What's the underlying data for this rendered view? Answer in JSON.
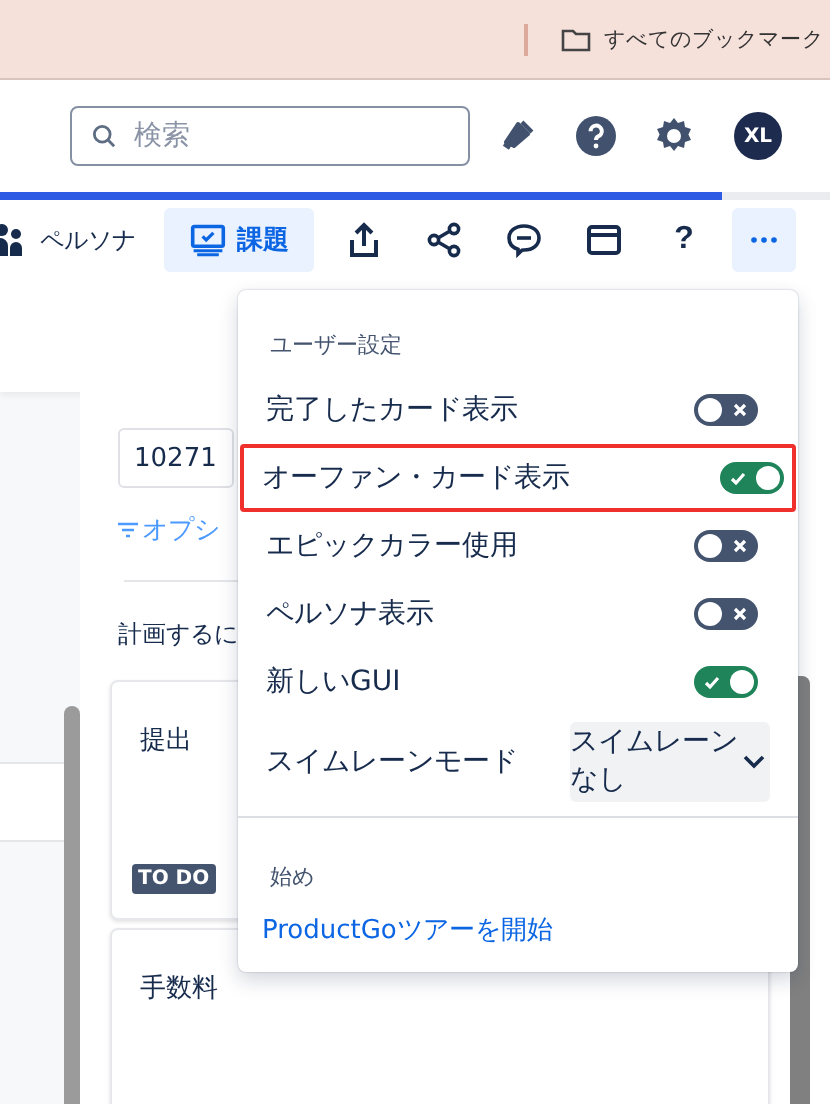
{
  "bookmarks_bar": {
    "label": "すべてのブックマーク"
  },
  "header": {
    "search": {
      "placeholder": "検索"
    },
    "avatar": "XL"
  },
  "progress": {
    "level": 0.87
  },
  "toolbar": {
    "tabs": [
      {
        "label": "ペルソナ",
        "selected": false
      },
      {
        "label": "課題",
        "selected": true
      }
    ],
    "icon_buttons": [
      {
        "kind": "upload",
        "selected": false
      },
      {
        "kind": "share",
        "selected": false
      },
      {
        "kind": "comment",
        "selected": false
      },
      {
        "kind": "window",
        "selected": false
      },
      {
        "kind": "help",
        "label": "?",
        "selected": false
      },
      {
        "kind": "more",
        "selected": true
      }
    ]
  },
  "board": {
    "filter_value": "10271",
    "options_link": "オプシ",
    "plan_text": "計画するに",
    "cards": [
      {
        "title": "提出",
        "status": "TO DO"
      },
      {
        "title": "手数料"
      }
    ]
  },
  "menu": {
    "section_title": "ユーザー設定",
    "items": [
      {
        "kind": "toggle",
        "label": "完了したカード表示",
        "on": false,
        "highlighted": false
      },
      {
        "kind": "toggle",
        "label": "オーファン・カード表示",
        "on": true,
        "highlighted": true
      },
      {
        "kind": "toggle",
        "label": "エピックカラー使用",
        "on": false,
        "highlighted": false
      },
      {
        "kind": "toggle",
        "label": "ペルソナ表示",
        "on": false,
        "highlighted": false
      },
      {
        "kind": "toggle",
        "label": "新しいGUI",
        "on": true,
        "highlighted": false
      },
      {
        "kind": "select",
        "label": "スイムレーンモード",
        "value": "スイムレーンなし",
        "highlighted": false
      }
    ],
    "start_title": "始め",
    "tour_link": "ProductGoツアーを開始"
  }
}
